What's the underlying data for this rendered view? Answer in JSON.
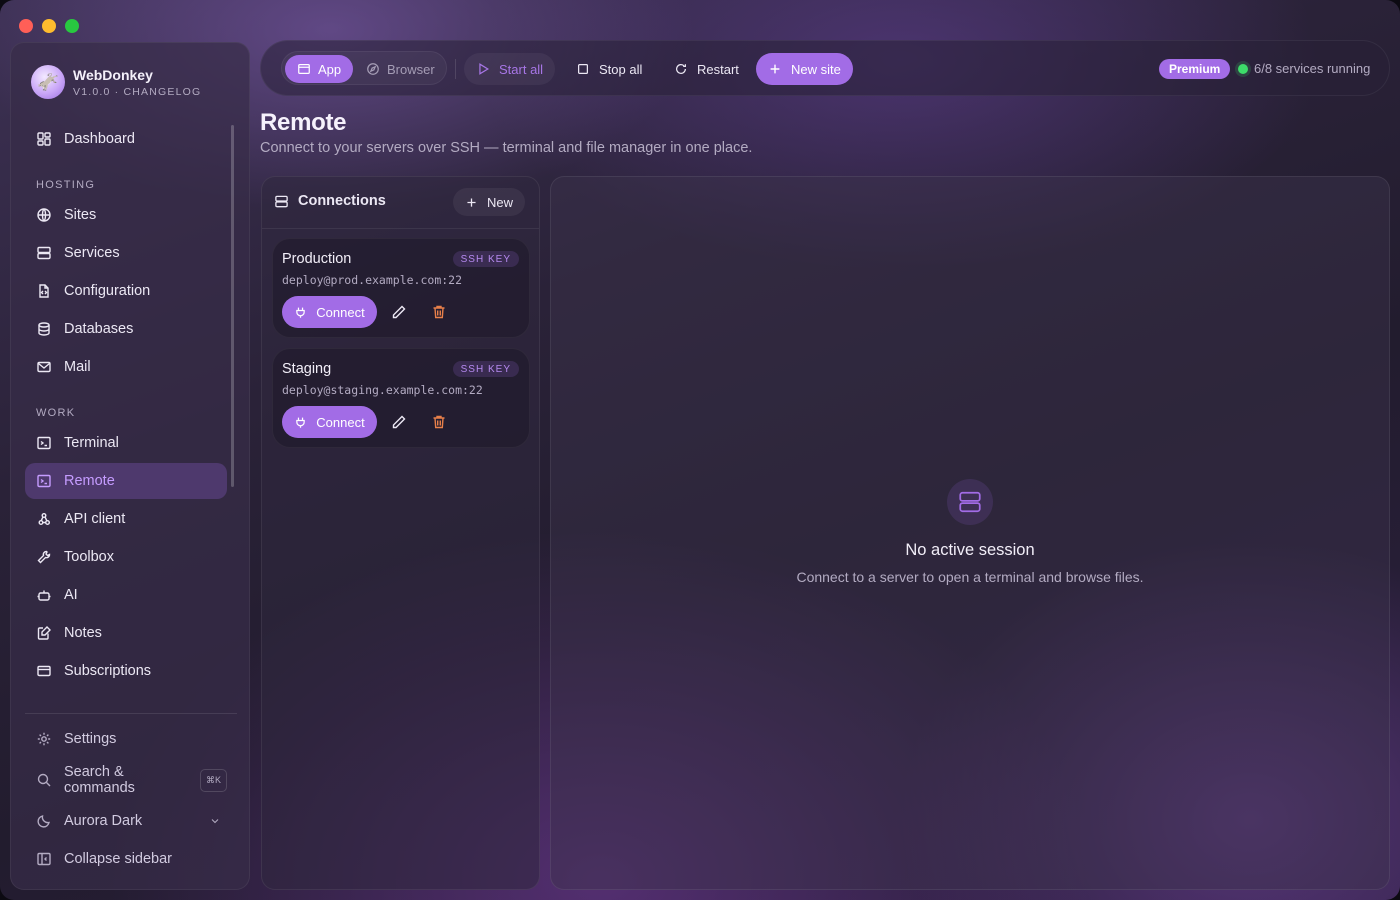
{
  "app": {
    "name": "WebDonkey",
    "version_line": "V1.0.0 · CHANGELOG"
  },
  "sidebar": {
    "items_top": [
      {
        "label": "Dashboard",
        "icon": "dashboard-icon"
      }
    ],
    "section_hosting": "HOSTING",
    "hosting_items": [
      {
        "label": "Sites",
        "icon": "globe-icon"
      },
      {
        "label": "Services",
        "icon": "server-icon"
      },
      {
        "label": "Configuration",
        "icon": "file-code-icon"
      },
      {
        "label": "Databases",
        "icon": "database-icon"
      },
      {
        "label": "Mail",
        "icon": "mail-icon"
      }
    ],
    "section_work": "WORK",
    "work_items": [
      {
        "label": "Terminal",
        "icon": "terminal-icon"
      },
      {
        "label": "Remote",
        "icon": "remote-terminal-icon",
        "active": true
      },
      {
        "label": "API client",
        "icon": "webhook-icon"
      },
      {
        "label": "Toolbox",
        "icon": "wrench-icon"
      },
      {
        "label": "AI",
        "icon": "bot-icon"
      },
      {
        "label": "Notes",
        "icon": "note-edit-icon"
      },
      {
        "label": "Subscriptions",
        "icon": "credit-card-icon"
      }
    ],
    "bottom_items": {
      "settings": "Settings",
      "search": "Search & commands",
      "search_shortcut": "⌘K",
      "theme": "Aurora Dark",
      "collapse": "Collapse sidebar"
    }
  },
  "toolbar": {
    "mode_app": "App",
    "mode_browser": "Browser",
    "start_all": "Start all",
    "stop_all": "Stop all",
    "restart": "Restart",
    "new_site": "New site",
    "plan_badge": "Premium",
    "services_status": "6/8 services running"
  },
  "page": {
    "title": "Remote",
    "subtitle": "Connect to your servers over SSH — terminal and file manager in one place."
  },
  "connections": {
    "title": "Connections",
    "new_label": "New",
    "items": [
      {
        "name": "Production",
        "badge": "SSH KEY",
        "host": "deploy@prod.example.com:22",
        "connect_label": "Connect"
      },
      {
        "name": "Staging",
        "badge": "SSH KEY",
        "host": "deploy@staging.example.com:22",
        "connect_label": "Connect"
      }
    ]
  },
  "session": {
    "empty_title": "No active session",
    "empty_subtitle": "Connect to a server to open a terminal and browse files."
  },
  "colors": {
    "accent": "#a26ce6",
    "active_nav_text": "#c59cff",
    "status_ok": "#3ddc6a",
    "danger_icon": "#e8804a"
  }
}
